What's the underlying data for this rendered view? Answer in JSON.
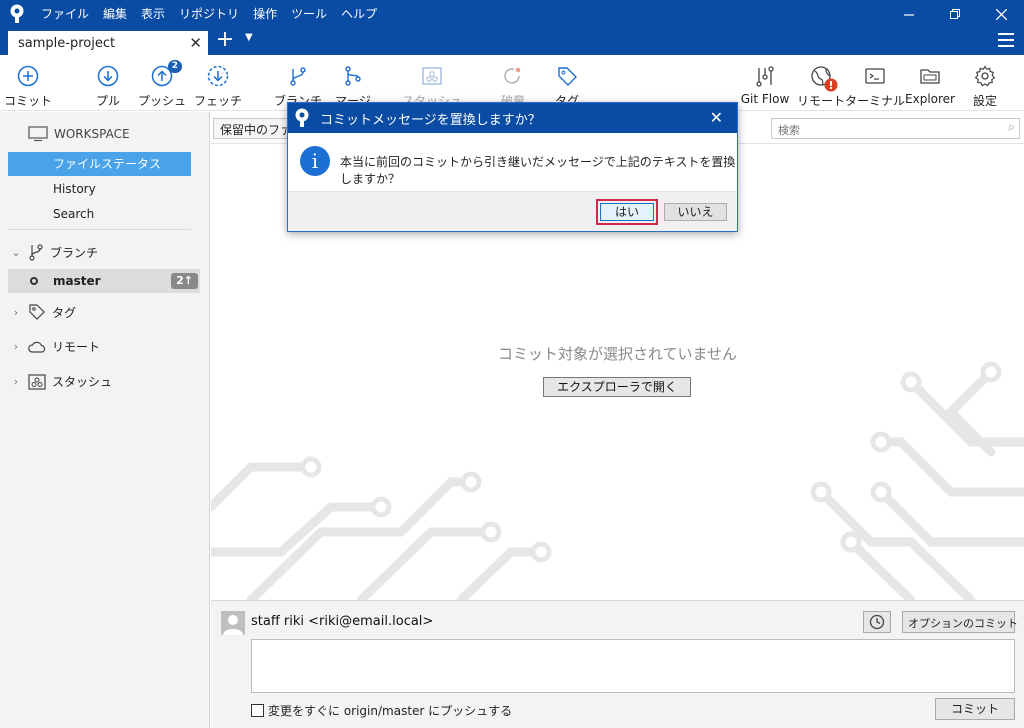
{
  "menu": [
    "ファイル",
    "編集",
    "表示",
    "リポジトリ",
    "操作",
    "ツール",
    "ヘルプ"
  ],
  "tab": {
    "title": "sample-project"
  },
  "toolbar": {
    "commit": "コミット",
    "pull": "プル",
    "push": "プッシュ",
    "push_badge": "2",
    "fetch": "フェッチ",
    "branch": "ブランチ",
    "merge": "マージ",
    "stash": "スタッシュ",
    "discard": "破棄",
    "tag": "タグ",
    "gitflow": "Git Flow",
    "remote": "リモート",
    "terminal": "ターミナル",
    "explorer": "Explorer",
    "settings": "設定"
  },
  "sidebar": {
    "workspace": "WORKSPACE",
    "file_status": "ファイルステータス",
    "history": "History",
    "search": "Search",
    "branches": "ブランチ",
    "branch_name": "master",
    "branch_badge": "2↑",
    "tags": "タグ",
    "remotes": "リモート",
    "stashes": "スタッシュ"
  },
  "main": {
    "filter_label": "保留中のファイル",
    "search_placeholder": "検索",
    "empty_message": "コミット対象が選択されていません",
    "open_explorer": "エクスプローラで開く"
  },
  "commit": {
    "author": "staff riki <riki@email.local>",
    "options": "オプションのコミット",
    "push_immediately": "変更をすぐに origin/master にプッシュする",
    "commit_button": "コミット"
  },
  "dialog": {
    "title": "コミットメッセージを置換しますか？",
    "message": "本当に前回のコミットから引き継いだメッセージで上記のテキストを置換しますか？",
    "yes": "はい",
    "no": "いいえ"
  },
  "colors": {
    "brand": "#0a4ba3",
    "accent": "#4aa3e8",
    "highlight": "#d0294c"
  }
}
